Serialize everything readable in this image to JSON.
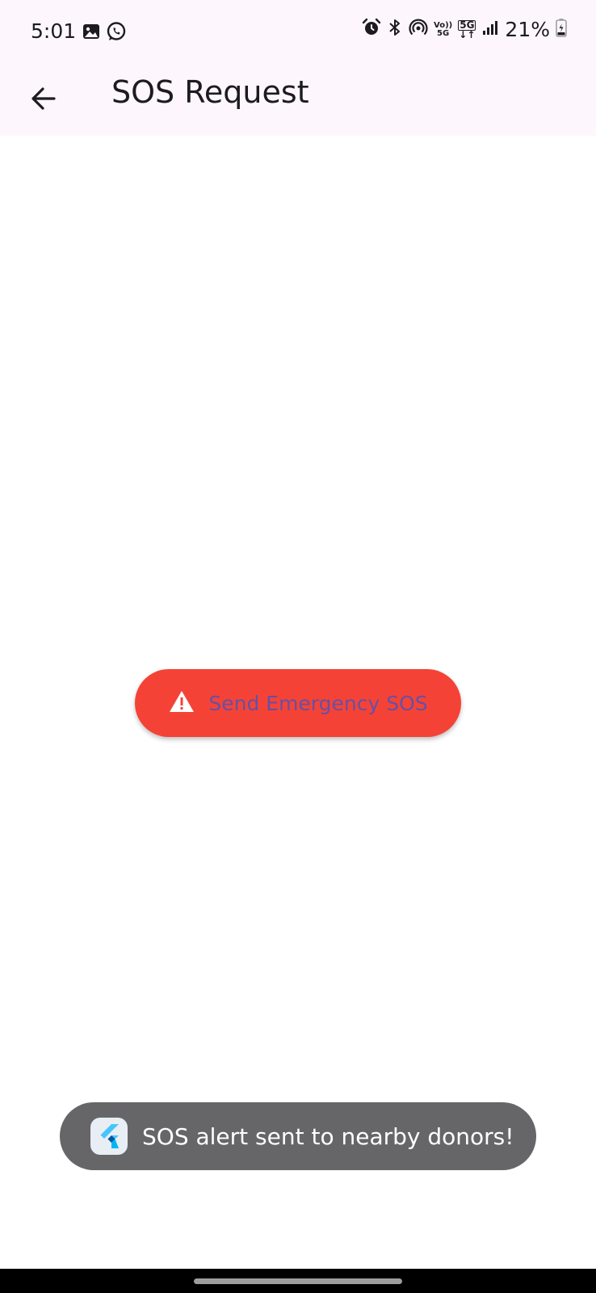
{
  "status_bar": {
    "time": "5:01",
    "left_icons": [
      "gallery-icon",
      "whatsapp-icon"
    ],
    "right_icons": [
      "alarm-icon",
      "bluetooth-icon",
      "hotspot-icon",
      "volte-icon",
      "5g-icon",
      "signal-icon"
    ],
    "volte_label_top": "Vo))",
    "volte_label_bottom": "5G",
    "net_label_top": "5G",
    "net_label_bottom": "↓↑",
    "battery": "21%"
  },
  "app_bar": {
    "title": "SOS Request",
    "back_icon": "arrow-back-icon"
  },
  "sos_button": {
    "label": "Send Emergency SOS",
    "icon": "warning-icon",
    "background": "#f44336",
    "label_color": "#6750a4"
  },
  "toast": {
    "message": "SOS alert sent to nearby donors!",
    "app_icon": "flutter-icon"
  },
  "colors": {
    "app_bar_bg": "#fdf7fd",
    "toast_bg": "#666668"
  }
}
